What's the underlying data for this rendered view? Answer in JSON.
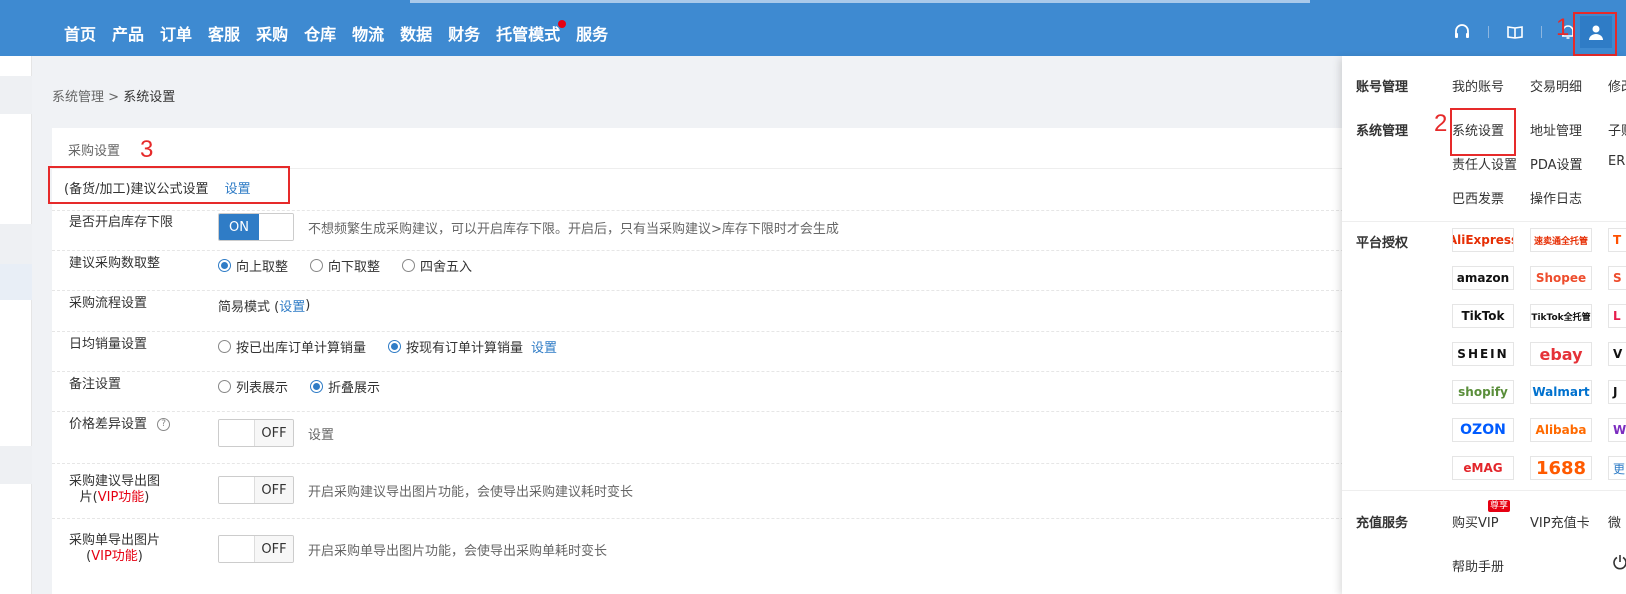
{
  "nav": {
    "items": [
      "首页",
      "产品",
      "订单",
      "客服",
      "采购",
      "仓库",
      "物流",
      "数据",
      "财务",
      "托管模式",
      "服务"
    ]
  },
  "annotations": [
    "1",
    "2",
    "3"
  ],
  "breadcrumb": {
    "parent": "系统管理",
    "separator": ">",
    "current": "系统设置"
  },
  "section": {
    "title": "采购设置"
  },
  "rows": {
    "formula": {
      "label": "(备货/加工)建议公式设置",
      "link": "设置"
    },
    "stock_limit": {
      "label": "是否开启库存下限",
      "toggle": "ON",
      "hint": "不想频繁生成采购建议，可以开启库存下限。开启后，只有当采购建议>库存下限时才会生成"
    },
    "rounding": {
      "label": "建议采购数取整",
      "options": [
        "向上取整",
        "向下取整",
        "四舍五入"
      ],
      "selected": "向上取整"
    },
    "process": {
      "label": "采购流程设置",
      "value_prefix": "简易模式 (",
      "link": "设置",
      "value_suffix": ")"
    },
    "daily_sales": {
      "label": "日均销量设置",
      "options": [
        "按已出库订单计算销量",
        "按现有订单计算销量"
      ],
      "selected": "按现有订单计算销量",
      "link": "设置"
    },
    "remark": {
      "label": "备注设置",
      "options": [
        "列表展示",
        "折叠展示"
      ],
      "selected": "折叠展示"
    },
    "price_diff": {
      "label": "价格差异设置",
      "help": "?",
      "toggle": "OFF",
      "text": "设置"
    },
    "suggest_export": {
      "label_a": "采购建议导出图",
      "label_b": "片(",
      "vip": "VIP功能",
      "label_c": ")",
      "toggle": "OFF",
      "hint": "开启采购建议导出图片功能，会使导出采购建议耗时变长"
    },
    "order_export": {
      "label_a": "采购单导出图片",
      "label_b": "(",
      "vip": "VIP功能",
      "label_c": ")",
      "toggle": "OFF",
      "hint": "开启采购单导出图片功能，会使导出采购单耗时变长"
    }
  },
  "dropdown": {
    "account": {
      "label": "账号管理",
      "links": [
        "我的账号",
        "交易明细",
        "修改"
      ]
    },
    "system": {
      "label": "系统管理",
      "links": [
        "系统设置",
        "地址管理",
        "子账",
        "责任人设置",
        "PDA设置",
        "ERP",
        "巴西发票",
        "操作日志"
      ]
    },
    "platforms": {
      "label": "平台授权",
      "items": [
        "AliExpress",
        "速卖通全托管",
        "T",
        "amazon",
        "Shopee",
        "S",
        "TikTok",
        "TikTok全托管",
        "L",
        "SHEIN",
        "ebay",
        "V",
        "shopify",
        "Walmart",
        "J",
        "OZON",
        "Alibaba",
        "W",
        "eMAG",
        "1688",
        "更"
      ]
    },
    "recharge": {
      "label": "充值服务",
      "links": [
        "购买VIP",
        "VIP充值卡",
        "微"
      ],
      "badge": "尊享"
    },
    "help": "帮助手册"
  },
  "colors": {
    "nav_bg": "#3e8ad1",
    "accent": "#2f7cc6",
    "annotation": "#e62a2a",
    "vip": "#e60012"
  }
}
